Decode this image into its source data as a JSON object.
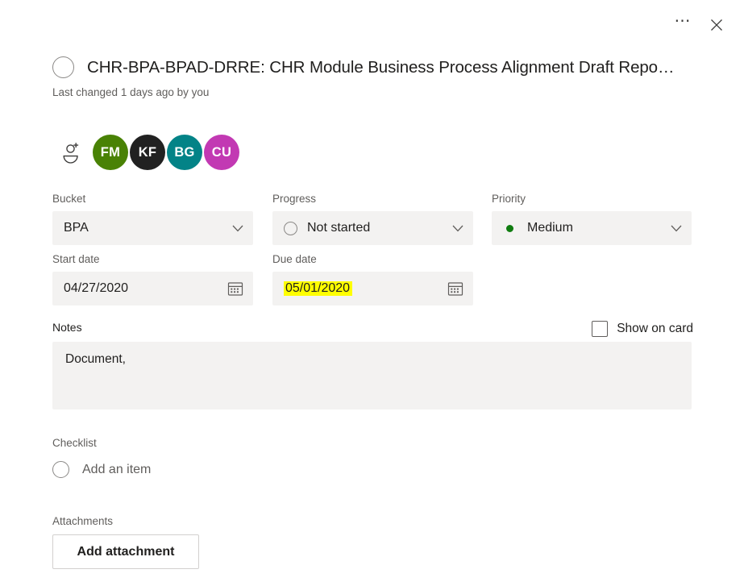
{
  "window": {
    "more_options_label": "•••",
    "more_options_name": "more-options-icon",
    "close_label": "✕"
  },
  "task": {
    "title": "CHR-BPA-BPAD-DRRE: CHR Module Business Process Alignment Draft Repo…",
    "last_changed": "Last changed 1 days ago by you",
    "completed": false
  },
  "assignees": {
    "add_person_icon": "add-person-icon",
    "members": [
      {
        "initials": "FM",
        "color": "#498205"
      },
      {
        "initials": "KF",
        "color": "#212121"
      },
      {
        "initials": "BG",
        "color": "#038387"
      },
      {
        "initials": "CU",
        "color": "#C239B3"
      }
    ]
  },
  "fields": {
    "bucket": {
      "label": "Bucket",
      "value": "BPA"
    },
    "progress": {
      "label": "Progress",
      "value": "Not started"
    },
    "priority": {
      "label": "Priority",
      "value": "Medium",
      "dot_color": "#107c10"
    },
    "start_date": {
      "label": "Start date",
      "value": "04/27/2020"
    },
    "due_date": {
      "label": "Due date",
      "value": "05/01/2020",
      "highlight_color": "#ffff00"
    }
  },
  "notes": {
    "label": "Notes",
    "value": "Document,",
    "show_on_card_label": "Show on card",
    "show_on_card_checked": false
  },
  "checklist": {
    "label": "Checklist",
    "add_item_label": "Add an item"
  },
  "attachments": {
    "label": "Attachments",
    "add_button_label": "Add attachment"
  }
}
